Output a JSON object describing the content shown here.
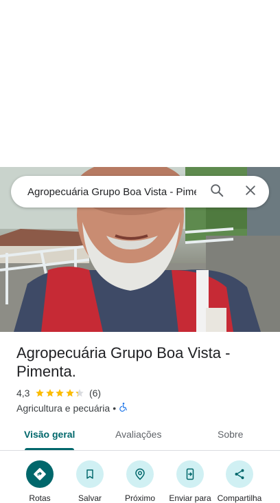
{
  "search": {
    "query": "Agropecuária Grupo Boa Vista - Pimenta.",
    "search_icon": "search-icon",
    "clear_icon": "close-icon"
  },
  "place": {
    "name": "Agropecuária Grupo Boa Vista - Pimenta.",
    "rating": "4,3",
    "rating_value": 4.3,
    "review_count": "(6)",
    "category": "Agricultura e pecuária",
    "separator": "•",
    "accessibility_icon": "wheelchair-icon",
    "star_color": "#fbbc04"
  },
  "tabs": [
    {
      "label": "Visão geral",
      "active": true
    },
    {
      "label": "Avaliações",
      "active": false
    },
    {
      "label": "Sobre",
      "active": false
    }
  ],
  "actions": [
    {
      "label": "Rotas",
      "icon": "directions-icon"
    },
    {
      "label": "Salvar",
      "icon": "bookmark-icon"
    },
    {
      "label": "Próximo",
      "icon": "nearby-icon"
    },
    {
      "label": "Enviar para",
      "icon": "send-to-phone-icon"
    },
    {
      "label": "Compartilha",
      "icon": "share-icon"
    }
  ],
  "colors": {
    "accent": "#00676b",
    "action_background": "#d0f0f3"
  }
}
